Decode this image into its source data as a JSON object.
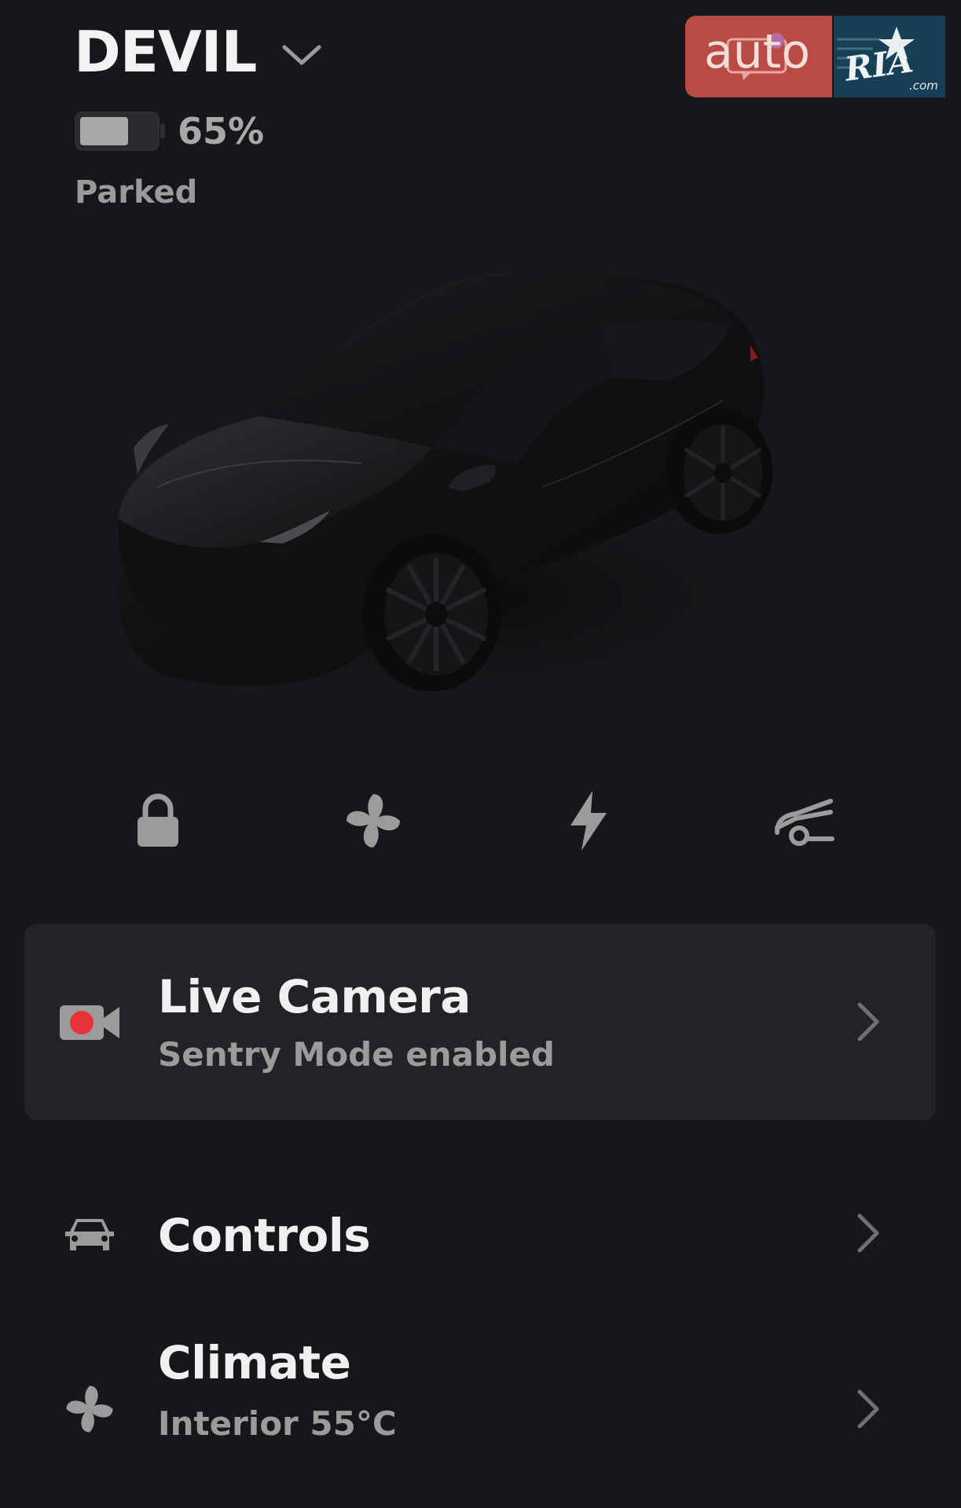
{
  "header": {
    "vehicle_name": "DEVIL",
    "battery_percent_text": "65%",
    "battery_level": 0.65,
    "status": "Parked"
  },
  "watermark": {
    "brand_text": "auto",
    "secondary_text": "RIA",
    "domain_text": ".com",
    "colors": {
      "auto_bg": "#b84b43",
      "ria_bg": "#173f55"
    }
  },
  "vehicle_image": {
    "description_icon": "black-suv-render"
  },
  "quick_actions": [
    {
      "name": "lock",
      "icon": "lock-icon"
    },
    {
      "name": "climate",
      "icon": "fan-icon"
    },
    {
      "name": "charge",
      "icon": "lightning-icon"
    },
    {
      "name": "trunk",
      "icon": "frunk-icon"
    }
  ],
  "live_camera": {
    "title": "Live Camera",
    "subtitle": "Sentry Mode enabled",
    "icon": "camera-record-icon",
    "accent": "#e8323a"
  },
  "controls": {
    "title": "Controls",
    "icon": "car-front-icon"
  },
  "climate": {
    "title": "Climate",
    "subtitle": "Interior 55°C",
    "icon": "fan-icon"
  },
  "colors": {
    "background": "#16171a",
    "card": "#222326",
    "icon_gray": "#9b9b9b",
    "text_primary": "#f0f0f0",
    "text_secondary": "#9b9b9b"
  }
}
